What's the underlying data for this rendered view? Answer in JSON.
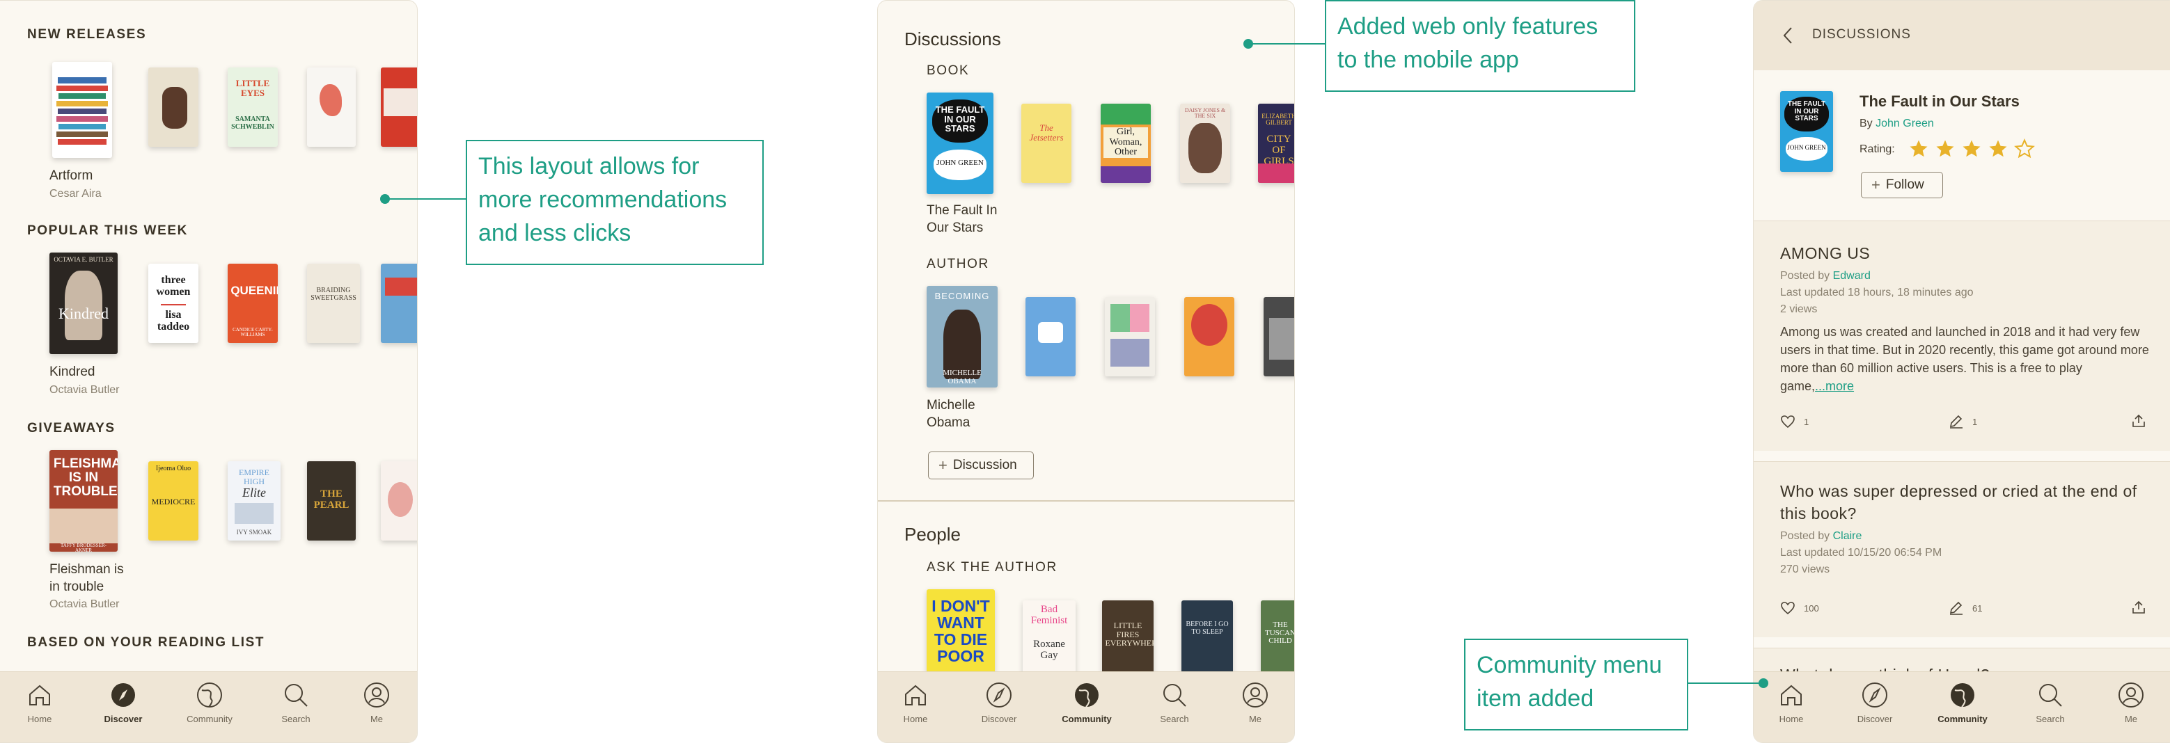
{
  "colors": {
    "accent": "#1e9e85",
    "cream": "#fbf8f1",
    "tabbar": "#efe6d6",
    "text": "#3a3326"
  },
  "discover": {
    "sections": {
      "new_releases": "NEW RELEASES",
      "popular": "POPULAR THIS WEEK",
      "giveaways": "GIVEAWAYS",
      "reading_list": "BASED ON YOUR READING LIST"
    },
    "books": {
      "artform": {
        "title": "Artform",
        "author": "Cesar Aira"
      },
      "kindred": {
        "title": "Kindred",
        "author": "Octavia Butler"
      },
      "fleishman": {
        "title": "Fleishman is in trouble",
        "author": "Octavia Butler"
      }
    },
    "covers": {
      "kindred": "Kindred",
      "kindred_top": "OCTAVIA E. BUTLER",
      "three_women": "three women",
      "lisa": "lisa taddeo",
      "queenie": "QUEENIE",
      "queenie_author": "CANDICE CARTY-WILLIAMS",
      "braiding": "BRAIDING SWEETGRASS",
      "fleishman": "FLEISHMAN IS IN TROUBLE",
      "fleishman_author": "TAFFY BRODESSER-AKNER",
      "ijeoma": "Ijeoma Oluo",
      "mediocre": "MEDIOCRE",
      "empire": "EMPIRE HIGH",
      "elite": "Elite",
      "ivy": "IVY SMOAK",
      "pearl": "THE PEARL",
      "little_eyes": "LITTLE EYES",
      "samanta": "SAMANTA SCHWEBLIN"
    }
  },
  "community": {
    "discussions_heading": "Discussions",
    "book_label": "BOOK",
    "book_title": "The Fault In Our Stars",
    "author_label": "AUTHOR",
    "author_name": "Michelle Obama",
    "discussion_button": "Discussion",
    "people_heading": "People",
    "ask_author": "ASK THE AUTHOR",
    "covers": {
      "tfios": "THE FAULT IN OUR STARS",
      "john_green": "JOHN GREEN",
      "jetsetters": "The Jetsetters",
      "girl": "Girl, Woman, Other",
      "daisy": "DAISY JONES & THE SIX",
      "city": "CITY OF GIRLS",
      "elizabeth": "ELIZABETH GILBERT",
      "becoming": "BECOMING",
      "michelle_cover": "MICHELLE OBAMA",
      "idontwant": "I DON'T WANT TO DIE POOR",
      "bad_feminist": "Bad Feminist",
      "roxane": "Roxane Gay",
      "little_fires": "LITTLE FIRES EVERYWHERE",
      "before": "BEFORE I GO TO SLEEP",
      "tuscan": "THE TUSCAN CHILD"
    }
  },
  "discussions_page": {
    "header": "DISCUSSIONS",
    "book_title": "The Fault in Our Stars",
    "by": "By",
    "author": "John Green",
    "rating_label": "Rating:",
    "rating": 4,
    "rating_max": 5,
    "follow": "Follow",
    "threads": [
      {
        "title": "AMONG US",
        "posted_by_label": "Posted by",
        "poster": "Edward",
        "updated": "Last updated 18 hours, 18 minutes ago",
        "views": "2 views",
        "body": "Among us was created and launched in 2018 and it had very few users in that time. But in 2020 recently, this game got around more more than 60 million active users. This is a free to play game,",
        "more": "...more",
        "likes": "1",
        "comments": "1"
      },
      {
        "title": "Who was super depressed or cried at the end of this book?",
        "posted_by_label": "Posted by",
        "poster": "Claire",
        "updated": "Last updated 10/15/20 06:54 PM",
        "views": "270 views",
        "likes": "100",
        "comments": "61"
      }
    ],
    "partial_next": "What do you think of Hazel?"
  },
  "tabs": [
    "Home",
    "Discover",
    "Community",
    "Search",
    "Me"
  ],
  "callouts": {
    "layout": "This layout allows for more recommendations and less clicks",
    "web_features": "Added web only features to the mobile app",
    "community_menu": "Community menu item added"
  }
}
